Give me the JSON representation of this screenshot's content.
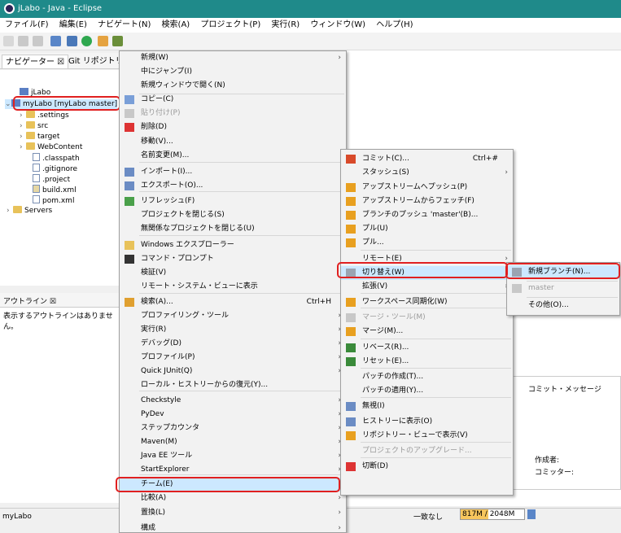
{
  "window": {
    "title": "jLabo - Java - Eclipse"
  },
  "menubar": [
    "ファイル(F)",
    "編集(E)",
    "ナビゲート(N)",
    "検索(A)",
    "プロジェクト(P)",
    "実行(R)",
    "ウィンドウ(W)",
    "ヘルプ(H)"
  ],
  "view_tabs": {
    "navigator": "ナビゲーター ☒",
    "git_repos": "Git リポジトリ"
  },
  "navigator": {
    "items": [
      ".settings",
      "src",
      "target",
      "WebContent",
      ".classpath",
      ".gitignore",
      ".project",
      "build.xml",
      "pom.xml",
      "Servers"
    ],
    "jlabo": "jLabo",
    "mylabo": "myLabo [myLabo master]"
  },
  "outline": {
    "tab": "アウトライン ☒",
    "message": "表示するアウトラインはありません。"
  },
  "status": {
    "left": "myLabo",
    "heap": "817M / 2048M",
    "filter": "一致なし",
    "commit_message_label": "コミット・メッセージ",
    "author_label": "作成者:",
    "committer_label": "コミッター:"
  },
  "context_menu": {
    "items": [
      {
        "label": "新規(W)",
        "shortcut": "",
        "submenu": true,
        "icon": "",
        "disabled": false
      },
      {
        "label": "中にジャンプ(I)",
        "shortcut": "",
        "submenu": false,
        "icon": "",
        "disabled": false
      },
      {
        "label": "新規ウィンドウで開く(N)",
        "shortcut": "",
        "submenu": false,
        "icon": "",
        "disabled": false
      },
      {
        "label": "コピー(C)",
        "shortcut": "",
        "submenu": false,
        "icon": "copy-icon",
        "disabled": false
      },
      {
        "label": "貼り付け(P)",
        "shortcut": "",
        "submenu": false,
        "icon": "paste-icon",
        "disabled": true
      },
      {
        "label": "削除(D)",
        "shortcut": "",
        "submenu": false,
        "icon": "delete-icon",
        "disabled": false
      },
      {
        "label": "移動(V)...",
        "shortcut": "",
        "submenu": false,
        "icon": "",
        "disabled": false
      },
      {
        "label": "名前変更(M)...",
        "shortcut": "",
        "submenu": false,
        "icon": "",
        "disabled": false
      },
      {
        "label": "インポート(I)...",
        "shortcut": "",
        "submenu": false,
        "icon": "import-icon",
        "disabled": false
      },
      {
        "label": "エクスポート(O)...",
        "shortcut": "",
        "submenu": false,
        "icon": "export-icon",
        "disabled": false
      },
      {
        "label": "リフレッシュ(F)",
        "shortcut": "",
        "submenu": false,
        "icon": "refresh-icon",
        "disabled": false
      },
      {
        "label": "プロジェクトを閉じる(S)",
        "shortcut": "",
        "submenu": false,
        "icon": "",
        "disabled": false
      },
      {
        "label": "無関係なプロジェクトを閉じる(U)",
        "shortcut": "",
        "submenu": false,
        "icon": "",
        "disabled": false
      },
      {
        "label": "Windows エクスプローラー",
        "shortcut": "",
        "submenu": false,
        "icon": "explorer-icon",
        "disabled": false
      },
      {
        "label": "コマンド・プロンプト",
        "shortcut": "",
        "submenu": false,
        "icon": "terminal-icon",
        "disabled": false
      },
      {
        "label": "検証(V)",
        "shortcut": "",
        "submenu": false,
        "icon": "",
        "disabled": false
      },
      {
        "label": "リモート・システム・ビューに表示",
        "shortcut": "",
        "submenu": false,
        "icon": "",
        "disabled": false
      },
      {
        "label": "検索(A)...",
        "shortcut": "Ctrl+H",
        "submenu": false,
        "icon": "search-icon",
        "disabled": false
      },
      {
        "label": "プロファイリング・ツール",
        "shortcut": "",
        "submenu": true,
        "icon": "",
        "disabled": false
      },
      {
        "label": "実行(R)",
        "shortcut": "",
        "submenu": true,
        "icon": "",
        "disabled": false
      },
      {
        "label": "デバッグ(D)",
        "shortcut": "",
        "submenu": true,
        "icon": "",
        "disabled": false
      },
      {
        "label": "プロファイル(P)",
        "shortcut": "",
        "submenu": true,
        "icon": "",
        "disabled": false
      },
      {
        "label": "Quick JUnit(Q)",
        "shortcut": "",
        "submenu": true,
        "icon": "",
        "disabled": false
      },
      {
        "label": "ローカル・ヒストリーからの復元(Y)...",
        "shortcut": "",
        "submenu": false,
        "icon": "",
        "disabled": false
      },
      {
        "label": "Checkstyle",
        "shortcut": "",
        "submenu": true,
        "icon": "",
        "disabled": false
      },
      {
        "label": "PyDev",
        "shortcut": "",
        "submenu": true,
        "icon": "",
        "disabled": false
      },
      {
        "label": "ステップカウンタ",
        "shortcut": "",
        "submenu": true,
        "icon": "",
        "disabled": false
      },
      {
        "label": "Maven(M)",
        "shortcut": "",
        "submenu": true,
        "icon": "",
        "disabled": false
      },
      {
        "label": "Java EE ツール",
        "shortcut": "",
        "submenu": true,
        "icon": "",
        "disabled": false
      },
      {
        "label": "StartExplorer",
        "shortcut": "",
        "submenu": true,
        "icon": "",
        "disabled": false
      },
      {
        "label": "チーム(E)",
        "shortcut": "",
        "submenu": true,
        "icon": "",
        "disabled": false
      },
      {
        "label": "比較(A)",
        "shortcut": "",
        "submenu": true,
        "icon": "",
        "disabled": false
      },
      {
        "label": "置換(L)",
        "shortcut": "",
        "submenu": true,
        "icon": "",
        "disabled": false
      },
      {
        "label": "構成",
        "shortcut": "",
        "submenu": true,
        "icon": "",
        "disabled": false
      }
    ]
  },
  "team_menu": {
    "items": [
      {
        "label": "コミット(C)...",
        "shortcut": "Ctrl+#",
        "submenu": false,
        "icon": "commit-icon",
        "disabled": false
      },
      {
        "label": "スタッシュ(S)",
        "shortcut": "",
        "submenu": true,
        "icon": "",
        "disabled": false
      },
      {
        "label": "アップストリームへプッシュ(P)",
        "shortcut": "",
        "submenu": false,
        "icon": "push-icon",
        "disabled": false
      },
      {
        "label": "アップストリームからフェッチ(F)",
        "shortcut": "",
        "submenu": false,
        "icon": "fetch-icon",
        "disabled": false
      },
      {
        "label": "ブランチのプッシュ 'master'(B)...",
        "shortcut": "",
        "submenu": false,
        "icon": "push-branch-icon",
        "disabled": false
      },
      {
        "label": "プル(U)",
        "shortcut": "",
        "submenu": false,
        "icon": "pull-icon",
        "disabled": false
      },
      {
        "label": "プル...",
        "shortcut": "",
        "submenu": false,
        "icon": "pull-dialog-icon",
        "disabled": false
      },
      {
        "label": "リモート(E)",
        "shortcut": "",
        "submenu": true,
        "icon": "",
        "disabled": false
      },
      {
        "label": "切り替え(W)",
        "shortcut": "",
        "submenu": true,
        "icon": "switch-icon",
        "disabled": false
      },
      {
        "label": "拡張(V)",
        "shortcut": "",
        "submenu": true,
        "icon": "",
        "disabled": false
      },
      {
        "label": "ワークスペース同期化(W)",
        "shortcut": "",
        "submenu": false,
        "icon": "sync-icon",
        "disabled": false
      },
      {
        "label": "マージ・ツール(M)",
        "shortcut": "",
        "submenu": false,
        "icon": "merge-tool-icon",
        "disabled": true
      },
      {
        "label": "マージ(M)...",
        "shortcut": "",
        "submenu": false,
        "icon": "merge-icon",
        "disabled": false
      },
      {
        "label": "リベース(R)...",
        "shortcut": "",
        "submenu": false,
        "icon": "rebase-icon",
        "disabled": false
      },
      {
        "label": "リセット(E)...",
        "shortcut": "",
        "submenu": false,
        "icon": "reset-icon",
        "disabled": false
      },
      {
        "label": "パッチの作成(T)...",
        "shortcut": "",
        "submenu": false,
        "icon": "",
        "disabled": false
      },
      {
        "label": "パッチの適用(Y)...",
        "shortcut": "",
        "submenu": false,
        "icon": "",
        "disabled": false
      },
      {
        "label": "無視(I)",
        "shortcut": "",
        "submenu": false,
        "icon": "ignore-icon",
        "disabled": false
      },
      {
        "label": "ヒストリーに表示(O)",
        "shortcut": "",
        "submenu": false,
        "icon": "history-icon",
        "disabled": false
      },
      {
        "label": "リポジトリー・ビューで表示(V)",
        "shortcut": "",
        "submenu": false,
        "icon": "repo-view-icon",
        "disabled": false
      },
      {
        "label": "プロジェクトのアップグレード...",
        "shortcut": "",
        "submenu": false,
        "icon": "",
        "disabled": true
      },
      {
        "label": "切断(D)",
        "shortcut": "",
        "submenu": false,
        "icon": "disconnect-icon",
        "disabled": false
      }
    ]
  },
  "switch_menu": {
    "items": [
      {
        "label": "新規ブランチ(N)...",
        "icon": "new-branch-icon",
        "disabled": false
      },
      {
        "label": "master",
        "icon": "branch-icon",
        "disabled": true
      },
      {
        "label": "その他(O)...",
        "icon": "",
        "disabled": false
      }
    ]
  }
}
